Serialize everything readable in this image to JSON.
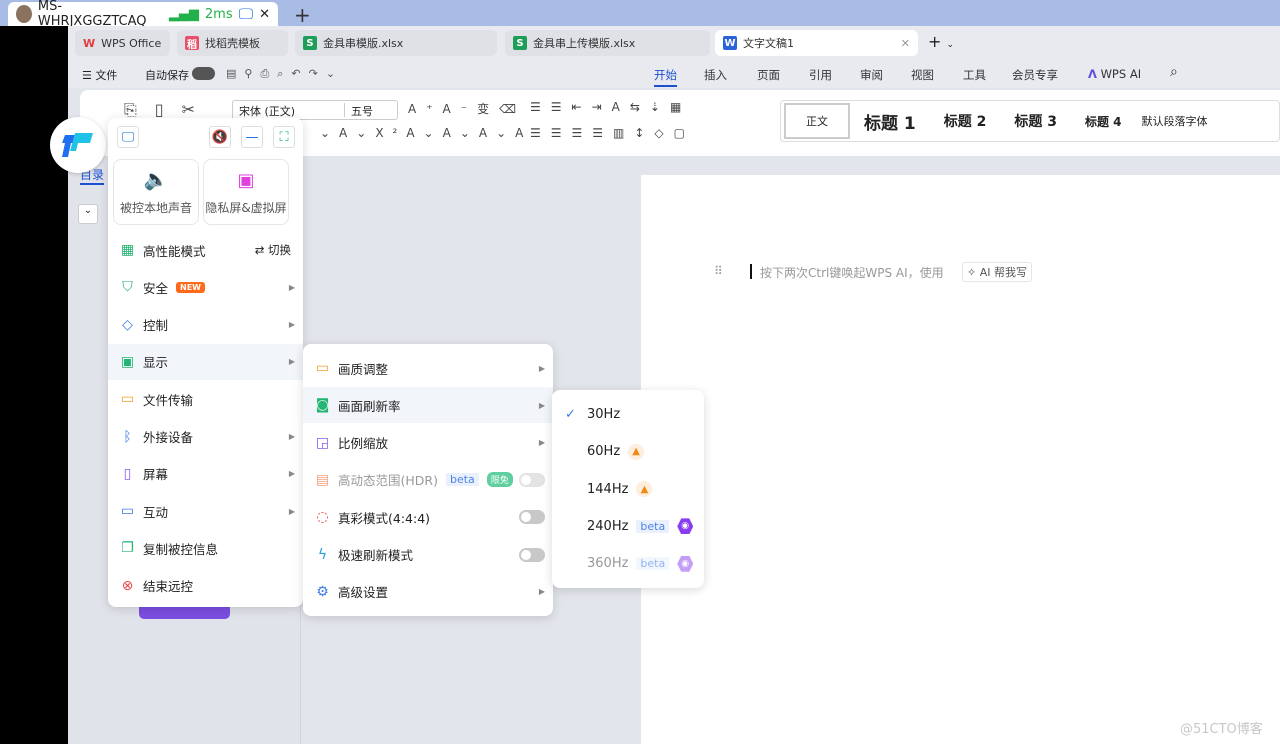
{
  "remote_tab": {
    "title": "MS-WHRJXGGZTCAQ",
    "latency": "2ms",
    "close": "✕",
    "new_tab": "+"
  },
  "wps_tabs": [
    {
      "label": "WPS Office",
      "icon": "W"
    },
    {
      "label": "找稻壳模板",
      "icon": "稻"
    },
    {
      "label": "金具串模版.xlsx",
      "icon": "S"
    },
    {
      "label": "金具串上传模版.xlsx",
      "icon": "S"
    },
    {
      "label": "文字文稿1",
      "icon": "W"
    }
  ],
  "menu_bar": {
    "file": "文件",
    "autosave": "自动保存",
    "tabs": [
      "开始",
      "插入",
      "页面",
      "引用",
      "审阅",
      "视图",
      "工具",
      "会员专享",
      "WPS AI"
    ]
  },
  "ribbon": {
    "font": "宋体 (正文)",
    "size": "五号",
    "styles": [
      "正文",
      "标题 1",
      "标题 2",
      "标题 3",
      "标题 4",
      "默认段落字体"
    ]
  },
  "left_pane": {
    "tab": "目录"
  },
  "doc": {
    "hint": "按下两次Ctrl键唤起WPS AI，使用",
    "ai_chip": "AI 帮我写"
  },
  "watermark": "@51CTO博客",
  "remote_menu": {
    "cards": [
      "被控本地声音",
      "隐私屏&虚拟屏"
    ],
    "items": [
      {
        "label": "高性能模式",
        "icon": "grid-icon",
        "glyph": "▦",
        "color": "#22b573",
        "extra": "⇄ 切换"
      },
      {
        "label": "安全",
        "icon": "shield-icon",
        "glyph": "⛉",
        "color": "#22b573",
        "badge": "NEW",
        "arrow": true
      },
      {
        "label": "控制",
        "icon": "layers-icon",
        "glyph": "◇",
        "color": "#3a7be6",
        "arrow": true
      },
      {
        "label": "显示",
        "icon": "monitor-icon",
        "glyph": "▣",
        "color": "#22b573",
        "arrow": true,
        "hl": true
      },
      {
        "label": "文件传输",
        "icon": "folder-icon",
        "glyph": "▭",
        "color": "#f5a030"
      },
      {
        "label": "外接设备",
        "icon": "bluetooth-device-icon",
        "glyph": "ᛒ",
        "color": "#3a7be6",
        "arrow": true
      },
      {
        "label": "屏幕",
        "icon": "screen-icon",
        "glyph": "▯",
        "color": "#8a5cf0",
        "arrow": true
      },
      {
        "label": "互动",
        "icon": "interact-icon",
        "glyph": "▭",
        "color": "#3a7be6",
        "arrow": true
      },
      {
        "label": "复制被控信息",
        "icon": "copy-icon",
        "glyph": "❐",
        "color": "#22b573"
      },
      {
        "label": "结束远控",
        "icon": "close-circle-icon",
        "glyph": "⊗",
        "color": "#e84c4c"
      }
    ]
  },
  "display_menu": [
    {
      "label": "画质调整",
      "icon": "quality-icon",
      "glyph": "▭",
      "color": "#f5a030",
      "arrow": true
    },
    {
      "label": "画面刷新率",
      "icon": "refresh-icon",
      "glyph": "◙",
      "color": "#22b573",
      "arrow": true,
      "hl": true
    },
    {
      "label": "比例缩放",
      "icon": "scale-icon",
      "glyph": "◲",
      "color": "#8a5cf0",
      "arrow": true
    },
    {
      "label": "高动态范围(HDR)",
      "icon": "hdr-icon",
      "glyph": "▤",
      "color": "#f5a080",
      "beta": "beta",
      "free": "限免",
      "toggle": false,
      "disabled": true
    },
    {
      "label": "真彩模式(4:4:4)",
      "icon": "color-ring-icon",
      "glyph": "◌",
      "color": "#e84c4c",
      "toggle": false
    },
    {
      "label": "极速刷新模式",
      "icon": "lightning-monitor-icon",
      "glyph": "ϟ",
      "color": "#2a9be6",
      "toggle": false
    },
    {
      "label": "高级设置",
      "icon": "gear-icon",
      "glyph": "⚙",
      "color": "#3a7be6",
      "arrow": true
    }
  ],
  "refresh_rates": [
    {
      "label": "30Hz",
      "selected": true
    },
    {
      "label": "60Hz",
      "badge": "rocket"
    },
    {
      "label": "144Hz",
      "badge": "rocket"
    },
    {
      "label": "240Hz",
      "beta": "beta",
      "badge": "game"
    },
    {
      "label": "360Hz",
      "beta": "beta",
      "badge": "game",
      "disabled": true
    }
  ]
}
